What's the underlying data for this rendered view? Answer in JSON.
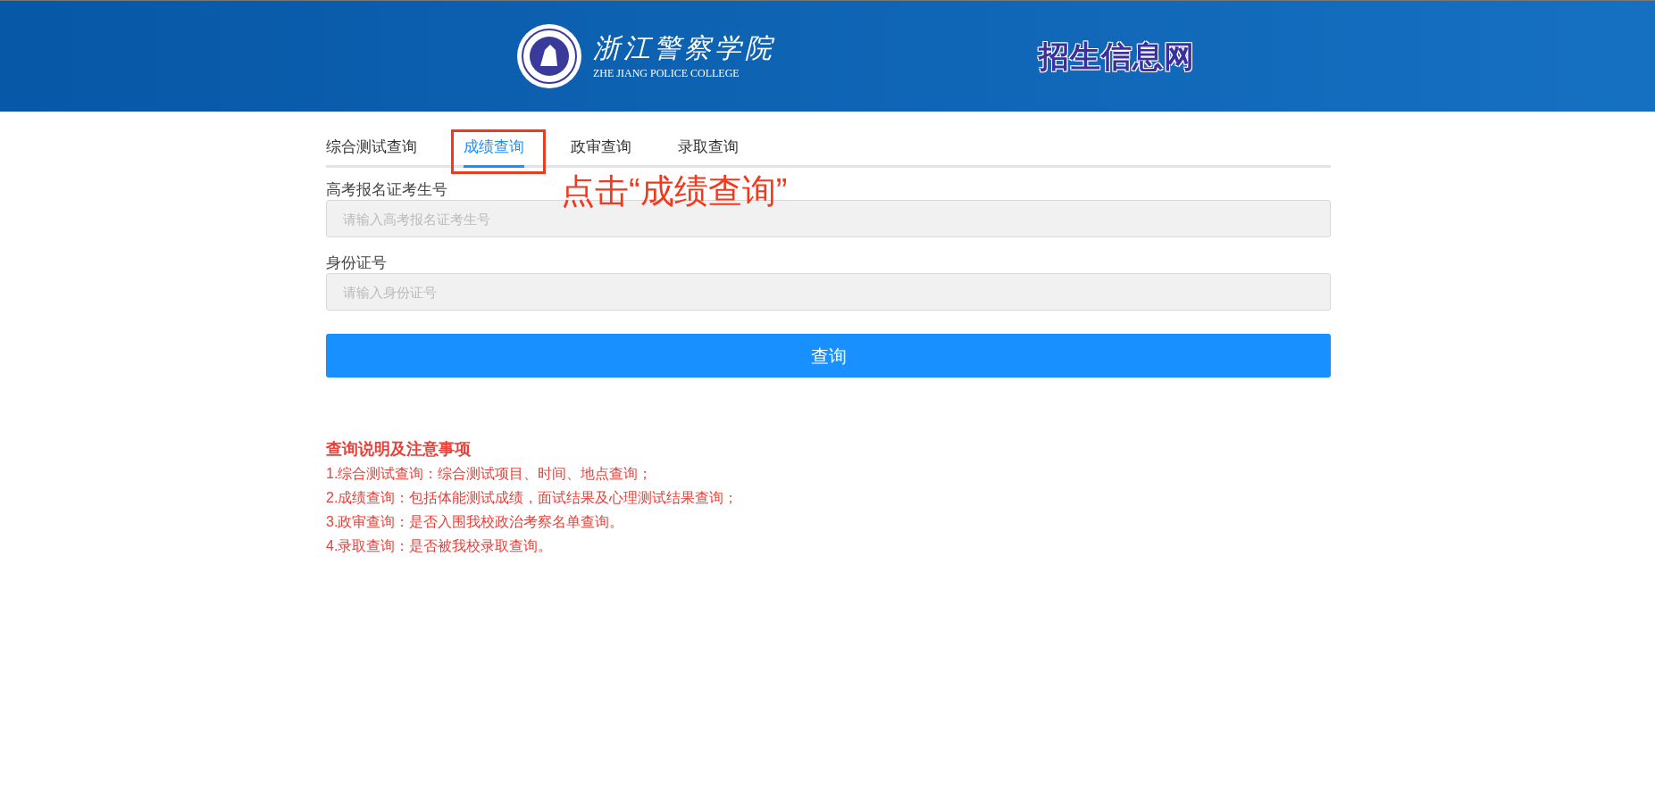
{
  "header": {
    "logo_text": "浙江警察学院",
    "logo_subtitle": "ZHE JIANG POLICE COLLEGE",
    "site_title": "招生信息网"
  },
  "tabs": [
    {
      "label": "综合测试查询",
      "selected": false
    },
    {
      "label": "成绩查询",
      "selected": true
    },
    {
      "label": "政审查询",
      "selected": false
    },
    {
      "label": "录取查询",
      "selected": false
    }
  ],
  "annotation": {
    "text": "点击“成绩查询”"
  },
  "form": {
    "fields": [
      {
        "label": "高考报名证考生号",
        "placeholder": "请输入高考报名证考生号"
      },
      {
        "label": "身份证号",
        "placeholder": "请输入身份证号"
      }
    ],
    "submit": "查询"
  },
  "notes": {
    "title": "查询说明及注意事项",
    "items": [
      "1.综合测试查询：综合测试项目、时间、地点查询；",
      "2.成绩查询：包括体能测试成绩，面试结果及心理测试结果查询；",
      "3.政审查询：是否入围我校政治考察名单查询。",
      "4.录取查询：是否被我校录取查询。"
    ]
  }
}
